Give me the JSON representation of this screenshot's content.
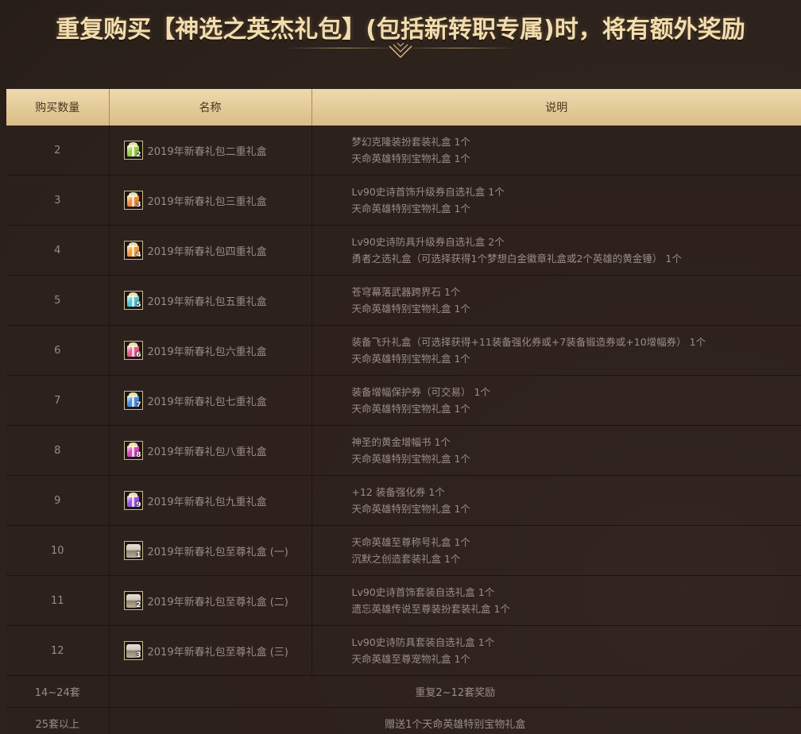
{
  "header": {
    "title": "重复购买【神选之英杰礼包】(包括新转职专属)时，将有额外奖励"
  },
  "table": {
    "columns": [
      "购买数量",
      "名称",
      "说明"
    ],
    "rows": [
      {
        "qty": "2",
        "name": "2019年新春礼包二重礼盒",
        "badge": "2",
        "icon": "gift-green-icon",
        "color": "#9acd45",
        "desc": [
          "梦幻克隆装扮套装礼盒 1个",
          "天命英雄特别宝物礼盒 1个"
        ]
      },
      {
        "qty": "3",
        "name": "2019年新春礼包三重礼盒",
        "badge": "3",
        "icon": "gift-orange-icon",
        "color": "#f08a3a",
        "desc": [
          "Lv90史诗首饰升级券自选礼盒 1个",
          "天命英雄特别宝物礼盒 1个"
        ]
      },
      {
        "qty": "4",
        "name": "2019年新春礼包四重礼盒",
        "badge": "4",
        "icon": "gift-orange-icon",
        "color": "#f09a3a",
        "desc": [
          "Lv90史诗防具升级券自选礼盒 2个",
          "勇者之选礼盒（可选择获得1个梦想白金徽章礼盒或2个英雄的黄金锤） 1个"
        ]
      },
      {
        "qty": "5",
        "name": "2019年新春礼包五重礼盒",
        "badge": "5",
        "icon": "gift-cyan-icon",
        "color": "#4ec7d8",
        "desc": [
          "苍穹幕落武器跨界石 1个",
          "天命英雄特别宝物礼盒 1个"
        ]
      },
      {
        "qty": "6",
        "name": "2019年新春礼包六重礼盒",
        "badge": "6",
        "icon": "gift-pink-icon",
        "color": "#e85a8a",
        "desc": [
          "装备飞升礼盒（可选择获得+11装备强化券或+7装备锻造券或+10增幅券） 1个",
          "天命英雄特别宝物礼盒 1个"
        ]
      },
      {
        "qty": "7",
        "name": "2019年新春礼包七重礼盒",
        "badge": "7",
        "icon": "gift-blue-icon",
        "color": "#4a8fe0",
        "desc": [
          "装备增幅保护券（可交易） 1个",
          "天命英雄特别宝物礼盒 1个"
        ]
      },
      {
        "qty": "8",
        "name": "2019年新春礼包八重礼盒",
        "badge": "8",
        "icon": "gift-magenta-icon",
        "color": "#d64ab8",
        "desc": [
          "神圣的黄金增幅书 1个",
          "天命英雄特别宝物礼盒 1个"
        ]
      },
      {
        "qty": "9",
        "name": "2019年新春礼包九重礼盒",
        "badge": "9",
        "icon": "gift-purple-icon",
        "color": "#9a55e0",
        "desc": [
          "+12 装备强化券 1个",
          "天命英雄特别宝物礼盒 1个"
        ]
      },
      {
        "qty": "10",
        "name": "2019年新春礼包至尊礼盒 (一)",
        "badge": "1",
        "icon": "chest-icon",
        "color": "#d8d0c4",
        "desc": [
          "天命英雄至尊称号礼盒 1个",
          "沉默之创造套装礼盒 1个"
        ]
      },
      {
        "qty": "11",
        "name": "2019年新春礼包至尊礼盒 (二)",
        "badge": "2",
        "icon": "chest-icon",
        "color": "#d8d0c4",
        "desc": [
          "Lv90史诗首饰套装自选礼盒 1个",
          "遗忘英雄传说至尊装扮套装礼盒 1个"
        ]
      },
      {
        "qty": "12",
        "name": "2019年新春礼包至尊礼盒 (三)",
        "badge": "3",
        "icon": "chest-icon",
        "color": "#d8d0c4",
        "desc": [
          "Lv90史诗防具套装自选礼盒 1个",
          "天命英雄至尊宠物礼盒 1个"
        ]
      }
    ],
    "summary_rows": [
      {
        "qty": "14~24套",
        "desc": "重复2~12套奖励"
      },
      {
        "qty": "25套以上",
        "desc": "赠送1个天命英雄特别宝物礼盒"
      }
    ]
  },
  "colors": {
    "background": "#2f2420",
    "header_cell": "#e6cd9b",
    "title_text": "#f3dcae",
    "body_text": "#9a8c86"
  }
}
